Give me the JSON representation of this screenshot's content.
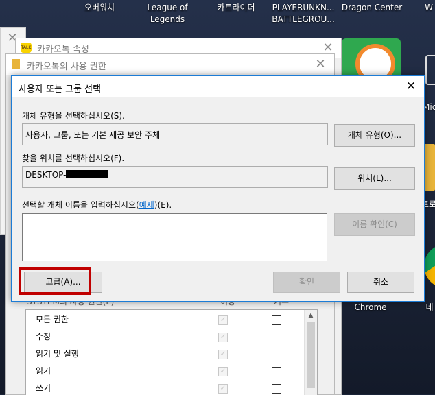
{
  "desktop": {
    "icons": [
      {
        "label": "오버워치"
      },
      {
        "label": "League of\nLegends"
      },
      {
        "label": "카트라이더"
      },
      {
        "label": "PLAYERUNKN...\nBATTLEGROU..."
      },
      {
        "label": "Dragon Center"
      },
      {
        "label": "W"
      },
      {
        "label": "Mic"
      },
      {
        "label": "트로"
      },
      {
        "label": "Chrome"
      },
      {
        "label": "네"
      }
    ]
  },
  "prop_window": {
    "title": "카카오톡 속성"
  },
  "perm_window": {
    "title": "카카오톡의 사용 권한",
    "group_header": "SYSTEM의 사용 권한(P)",
    "col_allow": "허용",
    "col_deny": "거부",
    "rows": [
      {
        "label": "모든 권한"
      },
      {
        "label": "수정"
      },
      {
        "label": "읽기 및 실행"
      },
      {
        "label": "읽기"
      },
      {
        "label": "쓰기"
      }
    ]
  },
  "dialog": {
    "title": "사용자 또는 그룹 선택",
    "object_type_label": "개체 유형을 선택하십시오(S).",
    "object_type_value": "사용자, 그룹, 또는 기본 제공 보안 주체",
    "object_type_button": "개체 유형(O)...",
    "location_label": "찾을 위치를 선택하십시오(F).",
    "location_value": "DESKTOP-",
    "location_button": "위치(L)...",
    "names_label_pre": "선택할 개체 이름을 입력하십시오(",
    "names_label_link": "예제",
    "names_label_post": ")(E).",
    "names_value": "",
    "check_names_button": "이름 확인(C)",
    "advanced_button": "고급(A)...",
    "ok_button": "확인",
    "cancel_button": "취소"
  },
  "colors": {
    "highlight_box": "#c00000",
    "dialog_border": "#1c7cd6"
  }
}
